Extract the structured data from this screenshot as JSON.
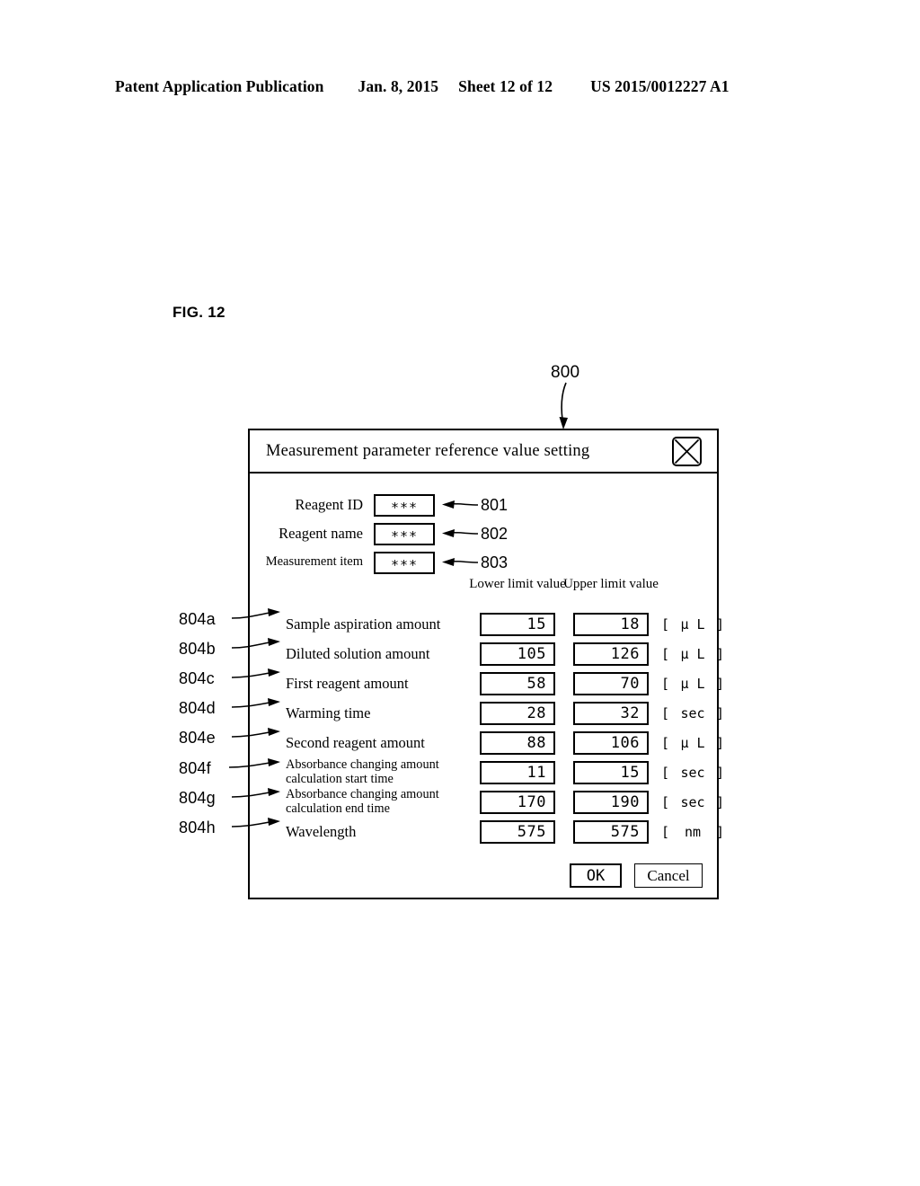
{
  "page_header": {
    "publication": "Patent Application Publication",
    "date": "Jan. 8, 2015",
    "sheet": "Sheet 12 of 12",
    "patent_number": "US 2015/0012227 A1"
  },
  "figure": {
    "label": "FIG. 12",
    "window_reference": "800"
  },
  "dialog": {
    "title": "Measurement parameter reference value setting",
    "close_icon": "close-x-icon",
    "info_fields": [
      {
        "label": "Reagent ID",
        "value": "∗∗∗",
        "reference": "801"
      },
      {
        "label": "Reagent name",
        "value": "∗∗∗",
        "reference": "802"
      },
      {
        "label": "Measurement item",
        "value": "∗∗∗",
        "reference": "803"
      }
    ],
    "column_headers": {
      "lower": "Lower limit value",
      "upper": "Upper limit value"
    },
    "parameters": [
      {
        "reference": "804a",
        "name": "Sample aspiration amount",
        "lower": "15",
        "upper": "18",
        "unit_open": "[",
        "unit_text": "μ L",
        "unit_close": "]"
      },
      {
        "reference": "804b",
        "name": "Diluted solution amount",
        "lower": "105",
        "upper": "126",
        "unit_open": "[",
        "unit_text": "μ L",
        "unit_close": "]"
      },
      {
        "reference": "804c",
        "name": "First reagent amount",
        "lower": "58",
        "upper": "70",
        "unit_open": "[",
        "unit_text": "μ L",
        "unit_close": "]"
      },
      {
        "reference": "804d",
        "name": "Warming time",
        "lower": "28",
        "upper": "32",
        "unit_open": "[",
        "unit_text": "sec",
        "unit_close": "]"
      },
      {
        "reference": "804e",
        "name": "Second reagent amount",
        "lower": "88",
        "upper": "106",
        "unit_open": "[",
        "unit_text": "μ L",
        "unit_close": "]"
      },
      {
        "reference": "804f",
        "name": "Absorbance changing amount calculation start time",
        "lower": "11",
        "upper": "15",
        "unit_open": "[",
        "unit_text": "sec",
        "unit_close": "]"
      },
      {
        "reference": "804g",
        "name": "Absorbance changing amount calculation end time",
        "lower": "170",
        "upper": "190",
        "unit_open": "[",
        "unit_text": "sec",
        "unit_close": "]"
      },
      {
        "reference": "804h",
        "name": "Wavelength",
        "lower": "575",
        "upper": "575",
        "unit_open": "[",
        "unit_text": "nm",
        "unit_close": "]"
      }
    ],
    "buttons": {
      "ok": "OK",
      "cancel": "Cancel"
    }
  }
}
